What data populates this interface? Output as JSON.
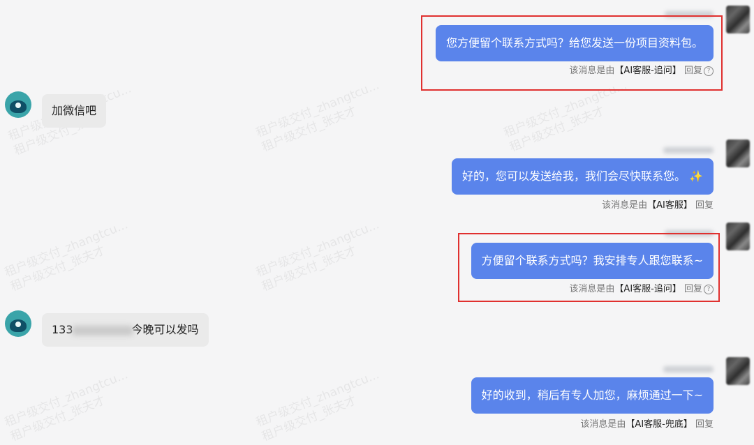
{
  "watermark": {
    "line1": "租户级交付_zhangtcu...",
    "line2": "租户级交付_张夫才"
  },
  "messages": [
    {
      "side": "right",
      "text": "您方便留个联系方式吗？给您发送一份项目资料包。",
      "meta_prefix": "该消息是由",
      "meta_source": "【AI客服-追问】",
      "meta_reply": "回复",
      "meta_help": "?"
    },
    {
      "side": "left",
      "text": "加微信吧"
    },
    {
      "side": "right",
      "text": "好的，您可以发送给我，我们会尽快联系您。",
      "emoji": "✨",
      "meta_prefix": "该消息是由",
      "meta_source": "【AI客服】",
      "meta_reply": "回复"
    },
    {
      "side": "right",
      "text": "方便留个联系方式吗？我安排专人跟您联系~",
      "meta_prefix": "该消息是由",
      "meta_source": "【AI客服-追问】",
      "meta_reply": "回复",
      "meta_help": "?"
    },
    {
      "side": "left",
      "text_start": "133",
      "text_end": "今晚可以发吗"
    },
    {
      "side": "right",
      "text": "好的收到，稍后有专人加您，麻烦通过一下~",
      "meta_prefix": "该消息是由",
      "meta_source": "【AI客服-兜底】",
      "meta_reply": "回复"
    }
  ],
  "icons": {
    "user": "user-avatar-icon",
    "agent": "agent-avatar-icon",
    "help": "question-circle-icon"
  },
  "colors": {
    "background": "#f5f5f6",
    "agent_bubble": "#5a84eb",
    "user_bubble": "#eaeaea",
    "highlight_box": "#e0302f"
  }
}
